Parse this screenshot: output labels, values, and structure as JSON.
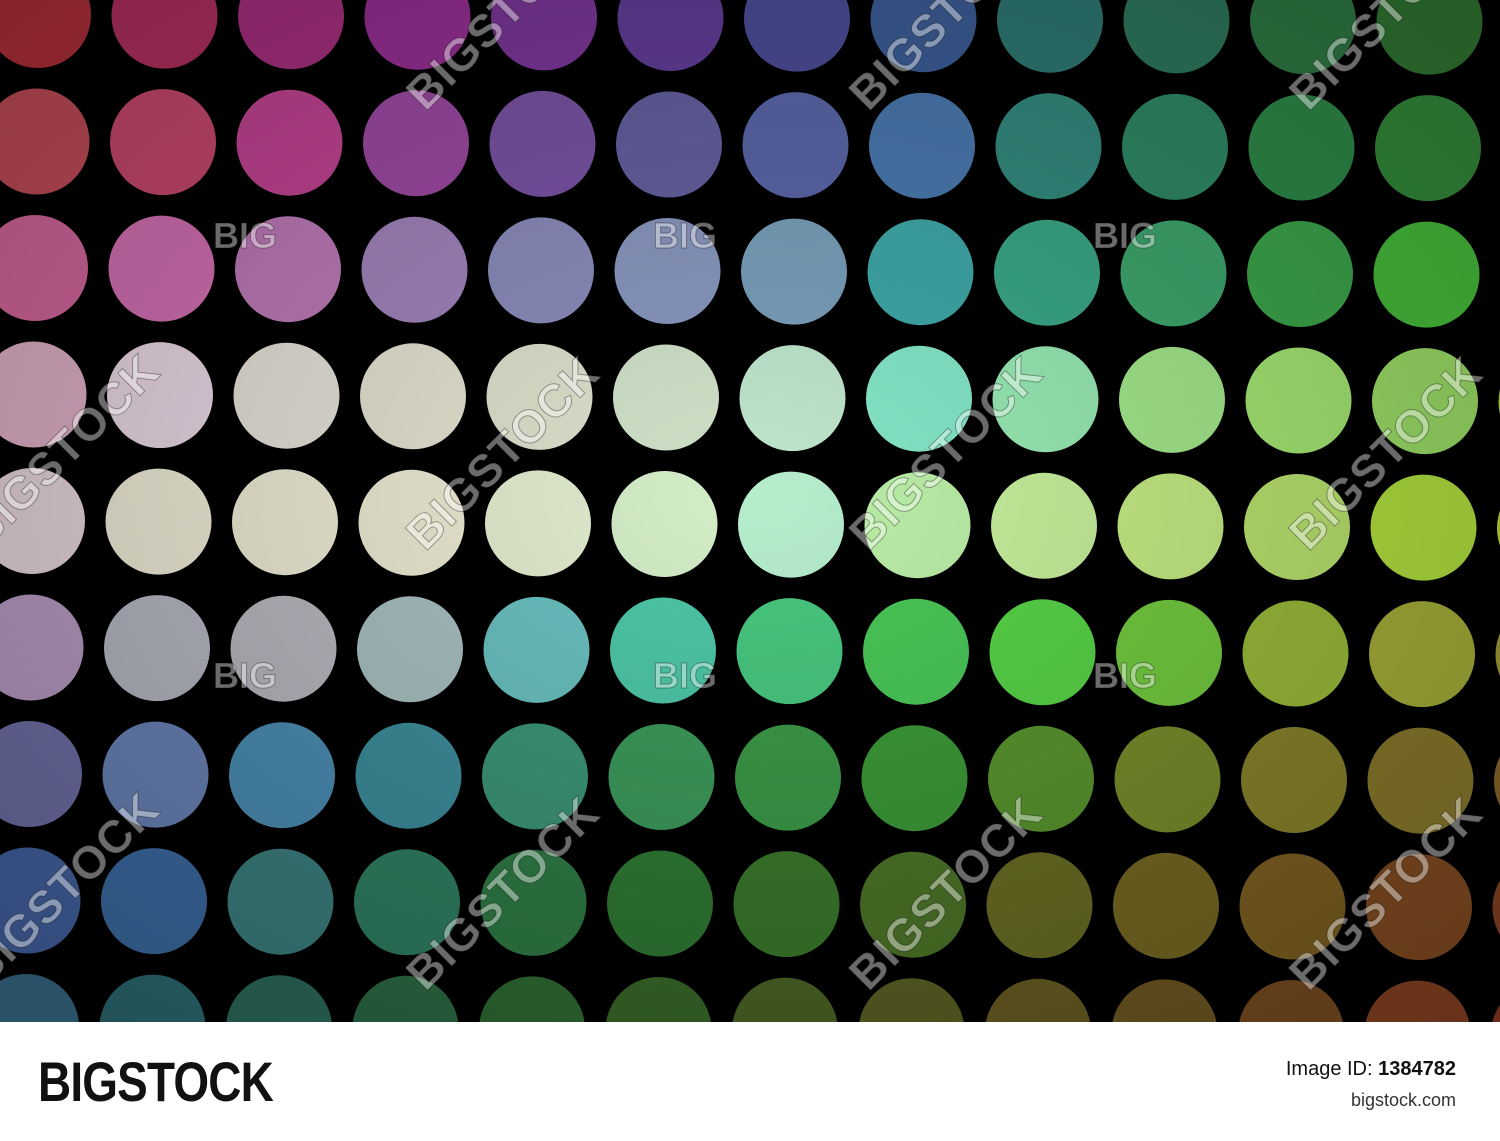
{
  "photo": {
    "subject": "rainbow-colored dots on black",
    "background_color": "#000000",
    "columns": 13,
    "rows": 9,
    "colors": [
      [
        "#b3303a",
        "#b43062",
        "#a93080",
        "#992f96",
        "#7e379c",
        "#633e9a",
        "#4d4e9a",
        "#3d5f9a",
        "#2f7a74",
        "#2f7a5e",
        "#2f7c45",
        "#327a33",
        "#2c7a2e"
      ],
      [
        "#c24c58",
        "#c8486e",
        "#c34494",
        "#9e4aa3",
        "#7b54a6",
        "#6561a2",
        "#5b67aa",
        "#4a7ab0",
        "#348c80",
        "#2f8c67",
        "#2f8c4a",
        "#348c3a",
        "#2d8a30"
      ],
      [
        "#d4669c",
        "#d470b3",
        "#be7ab8",
        "#a184bc",
        "#8c8cbd",
        "#8a98c0",
        "#7aa0bc",
        "#3fa8a8",
        "#3aa888",
        "#3ea86e",
        "#3ca84c",
        "#47c03b",
        "#46b03a"
      ],
      [
        "#e0b0c8",
        "#ead8e6",
        "#e6e2d8",
        "#e4e2d0",
        "#dde0cc",
        "#cfe2c8",
        "#bfe6cc",
        "#84e6c8",
        "#98eab4",
        "#a4ea8c",
        "#a6ea74",
        "#9ee268",
        "#aadc3c"
      ],
      [
        "#e8d6dc",
        "#f0ecd8",
        "#eeecd6",
        "#ecead2",
        "#e2ecce",
        "#d4eec8",
        "#b6eecc",
        "#bcf0a8",
        "#c8f09c",
        "#c6ee84",
        "#bce670",
        "#b4e440",
        "#c2dc3a"
      ],
      [
        "#b89cc4",
        "#b6b8c4",
        "#b8b8c0",
        "#a8c0c0",
        "#6ac0c0",
        "#4ec8a8",
        "#48c880",
        "#4ac858",
        "#58d448",
        "#74cc40",
        "#9cbe3a",
        "#a8b23a",
        "#a8a03a"
      ],
      [
        "#7070a8",
        "#6a84b8",
        "#4c8eb4",
        "#3c8e9c",
        "#3c9678",
        "#3c9a5c",
        "#3c9a48",
        "#3c9a38",
        "#5a962e",
        "#7a8e2c",
        "#8a862c",
        "#8c7c2c",
        "#8e6a2c"
      ],
      [
        "#4464a4",
        "#3c6ca4",
        "#3c8080",
        "#2f8062",
        "#2f7c46",
        "#2f7a34",
        "#3a7a2c",
        "#4e7628",
        "#6a6e24",
        "#786a22",
        "#806222",
        "#864e22",
        "#8a4424"
      ],
      [
        "#366c8a",
        "#2c6c74",
        "#2c6c5c",
        "#2c6c44",
        "#2f6c34",
        "#3a6a2a",
        "#4c6626",
        "#5c6224",
        "#6a5e22",
        "#705a22",
        "#7a4e22",
        "#8a4422",
        "#903824"
      ]
    ]
  },
  "watermarks": {
    "diagonal": "BIGSTOCK",
    "short": "BIG"
  },
  "footer": {
    "brand": "BIGSTOCK",
    "image_id_label": "Image ID:",
    "image_id": "1384782",
    "site_url": "bigstock.com"
  }
}
